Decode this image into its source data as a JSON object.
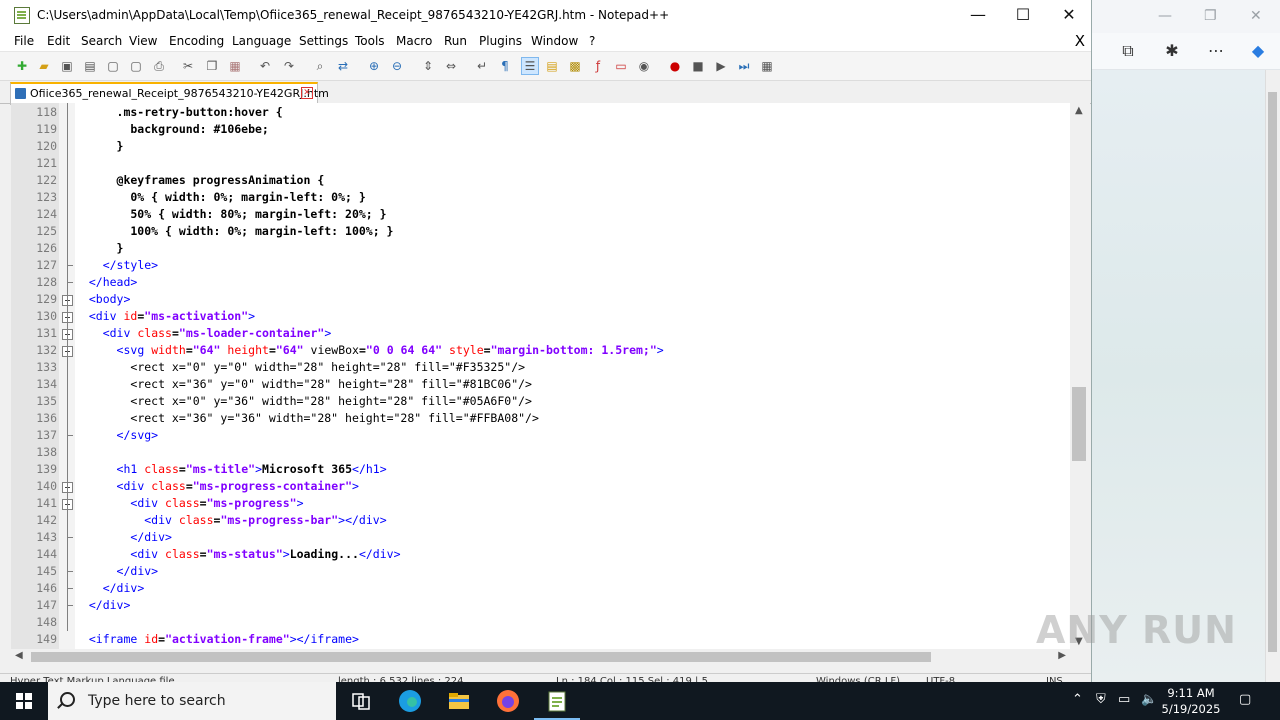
{
  "window": {
    "title": "C:\\Users\\admin\\AppData\\Local\\Temp\\Ofiice365_renewal_Receipt_9876543210-YE42GRJ.htm - Notepad++",
    "minimize": "—",
    "maximize": "☐",
    "close": "✕"
  },
  "menu": [
    "File",
    "Edit",
    "Search",
    "View",
    "Encoding",
    "Language",
    "Settings",
    "Tools",
    "Macro",
    "Run",
    "Plugins",
    "Window",
    "?"
  ],
  "menu_close": "X",
  "tab": {
    "label": "Ofiice365_renewal_Receipt_9876543210-YE42GRJ.htm"
  },
  "editor": {
    "lines": [
      {
        "n": "118",
        "html": "      .ms-retry-button:hover {"
      },
      {
        "n": "119",
        "html": "        background: #106ebe;"
      },
      {
        "n": "120",
        "html": "      }"
      },
      {
        "n": "121",
        "html": ""
      },
      {
        "n": "122",
        "html": "      @keyframes progressAnimation {"
      },
      {
        "n": "123",
        "html": "        0% { width: 0%; margin-left: 0%; }"
      },
      {
        "n": "124",
        "html": "        50% { width: 80%; margin-left: 20%; }"
      },
      {
        "n": "125",
        "html": "        100% { width: 0%; margin-left: 100%; }"
      },
      {
        "n": "126",
        "html": "      }"
      },
      {
        "n": "127",
        "html": "    <span class='tag'>&lt;/style&gt;</span>"
      },
      {
        "n": "128",
        "html": "  <span class='tag'>&lt;/head&gt;</span>"
      },
      {
        "n": "129",
        "html": "  <span class='tag'>&lt;body&gt;</span>"
      },
      {
        "n": "130",
        "html": "  <span class='tag'>&lt;div</span> <span class='attr'>id</span>=<span class='val'>\"ms-activation\"</span><span class='tag'>&gt;</span>"
      },
      {
        "n": "131",
        "html": "    <span class='tag'>&lt;div</span> <span class='attr'>class</span>=<span class='val'>\"ms-loader-container\"</span><span class='tag'>&gt;</span>"
      },
      {
        "n": "132",
        "html": "      <span class='tag'>&lt;svg</span> <span class='attr'>width</span>=<span class='val'>\"64\"</span> <span class='attr'>height</span>=<span class='val'>\"64\"</span> <span style='font-weight:normal'>viewBox</span>=<span class='val'>\"0 0 64 64\"</span> <span class='attr'>style</span>=<span class='val'>\"margin-bottom: 1.5rem;\"</span><span class='tag'>&gt;</span>"
      },
      {
        "n": "133",
        "html": "        <span style='font-weight:normal'>&lt;rect x=\"0\" y=\"0\" width=\"28\" height=\"28\" fill=\"#F35325\"/&gt;</span>"
      },
      {
        "n": "134",
        "html": "        <span style='font-weight:normal'>&lt;rect x=\"36\" y=\"0\" width=\"28\" height=\"28\" fill=\"#81BC06\"/&gt;</span>"
      },
      {
        "n": "135",
        "html": "        <span style='font-weight:normal'>&lt;rect x=\"0\" y=\"36\" width=\"28\" height=\"28\" fill=\"#05A6F0\"/&gt;</span>"
      },
      {
        "n": "136",
        "html": "        <span style='font-weight:normal'>&lt;rect x=\"36\" y=\"36\" width=\"28\" height=\"28\" fill=\"#FFBA08\"/&gt;</span>"
      },
      {
        "n": "137",
        "html": "      <span class='tag'>&lt;/svg&gt;</span>"
      },
      {
        "n": "138",
        "html": ""
      },
      {
        "n": "139",
        "html": "      <span class='tag'>&lt;h1</span> <span class='attr'>class</span>=<span class='val'>\"ms-title\"</span><span class='tag'>&gt;</span>Microsoft 365<span class='tag'>&lt;/h1&gt;</span>"
      },
      {
        "n": "140",
        "html": "      <span class='tag'>&lt;div</span> <span class='attr'>class</span>=<span class='val'>\"ms-progress-container\"</span><span class='tag'>&gt;</span>"
      },
      {
        "n": "141",
        "html": "        <span class='tag'>&lt;div</span> <span class='attr'>class</span>=<span class='val'>\"ms-progress\"</span><span class='tag'>&gt;</span>"
      },
      {
        "n": "142",
        "html": "          <span class='tag'>&lt;div</span> <span class='attr'>class</span>=<span class='val'>\"ms-progress-bar\"</span><span class='tag'>&gt;&lt;/div&gt;</span>"
      },
      {
        "n": "143",
        "html": "        <span class='tag'>&lt;/div&gt;</span>"
      },
      {
        "n": "144",
        "html": "        <span class='tag'>&lt;div</span> <span class='attr'>class</span>=<span class='val'>\"ms-status\"</span><span class='tag'>&gt;</span>Loading...<span class='tag'>&lt;/div&gt;</span>"
      },
      {
        "n": "145",
        "html": "      <span class='tag'>&lt;/div&gt;</span>"
      },
      {
        "n": "146",
        "html": "    <span class='tag'>&lt;/div&gt;</span>"
      },
      {
        "n": "147",
        "html": "  <span class='tag'>&lt;/div&gt;</span>"
      },
      {
        "n": "148",
        "html": ""
      },
      {
        "n": "149",
        "html": "  <span class='tag'>&lt;iframe</span> <span class='attr'>id</span>=<span class='val'>\"activation-frame\"</span><span class='tag'>&gt;&lt;/iframe&gt;</span>"
      }
    ]
  },
  "statusbar": {
    "type": "Hyper Text Markup Language file",
    "length": "length : 6,532    lines : 224",
    "position": "Ln : 184    Col : 115    Sel : 419 | 5",
    "eol": "Windows (CR LF)",
    "encoding": "UTF-8",
    "mode": "INS"
  },
  "taskbar": {
    "search_placeholder": "Type here to search",
    "time": "9:11 AM",
    "date": "5/19/2025"
  },
  "watermark": "ANY RUN"
}
